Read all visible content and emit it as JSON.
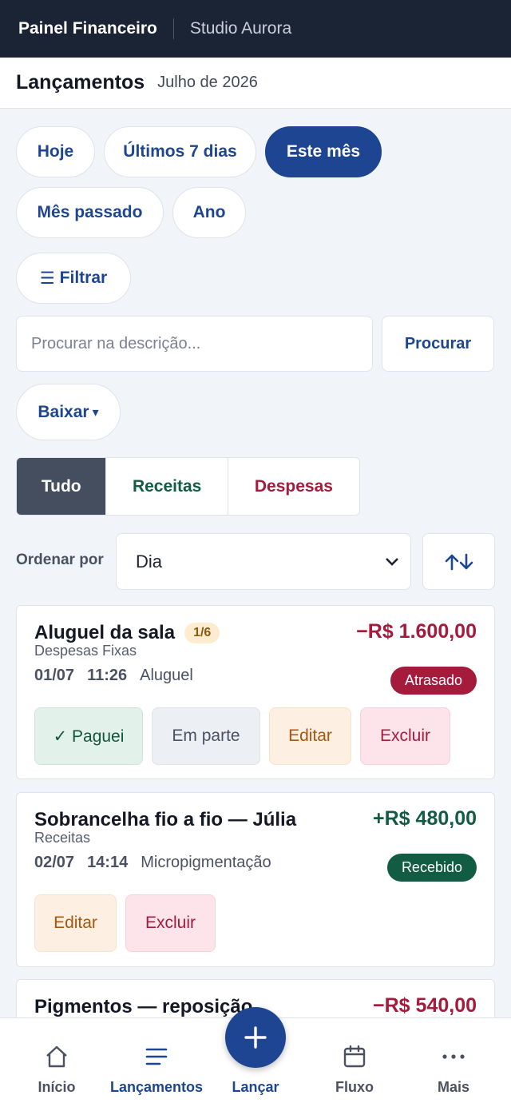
{
  "app": {
    "brand": "Painel Financeiro",
    "workspace": "Studio Aurora"
  },
  "header": {
    "title": "Lançamentos",
    "period": "Julho de 2026"
  },
  "periods": [
    "Hoje",
    "Últimos 7 dias",
    "Este mês",
    "Mês passado",
    "Ano"
  ],
  "active_period": "Este mês",
  "filter": {
    "label": "Filtrar"
  },
  "search": {
    "placeholder": "Procurar na descrição...",
    "value": "",
    "button": "Procurar"
  },
  "download": {
    "label": "Baixar"
  },
  "type_filter": {
    "options": [
      "Tudo",
      "Receitas",
      "Despesas"
    ],
    "selected": "Tudo"
  },
  "sort": {
    "label": "Ordenar por",
    "value": "Dia"
  },
  "entries": [
    {
      "title": "Aluguel da sala",
      "installment": "1/6",
      "category": "Despesas Fixas",
      "date": "01/07",
      "time": "11:26",
      "subcategory": "Aluguel",
      "amount": "−R$ 1.600,00",
      "kind": "expense",
      "status": "Atrasado",
      "actions": {
        "pay": "✓ Paguei",
        "partial": "Em parte",
        "edit": "Editar",
        "delete": "Excluir"
      }
    },
    {
      "title": "Sobrancelha fio a fio — Júlia",
      "category": "Receitas",
      "date": "02/07",
      "time": "14:14",
      "subcategory": "Micropigmentação",
      "amount": "+R$ 480,00",
      "kind": "income",
      "status": "Recebido",
      "actions": {
        "edit": "Editar",
        "delete": "Excluir"
      }
    },
    {
      "title": "Pigmentos — reposição",
      "amount": "−R$ 540,00",
      "kind": "expense"
    }
  ],
  "nav": [
    {
      "label": "Início",
      "icon": "home-icon"
    },
    {
      "label": "Lançamentos",
      "icon": "list-icon",
      "active": true
    },
    {
      "label": "Lançar",
      "icon": "plus-icon"
    },
    {
      "label": "Fluxo",
      "icon": "calendar-icon"
    },
    {
      "label": "Mais",
      "icon": "more-icon"
    }
  ],
  "colors": {
    "primary": "#1d4592",
    "topbar": "#1b2434",
    "expense": "#a51b3c",
    "income": "#135c44",
    "overdue_badge": "#a51b3c",
    "received_badge": "#135c44"
  }
}
